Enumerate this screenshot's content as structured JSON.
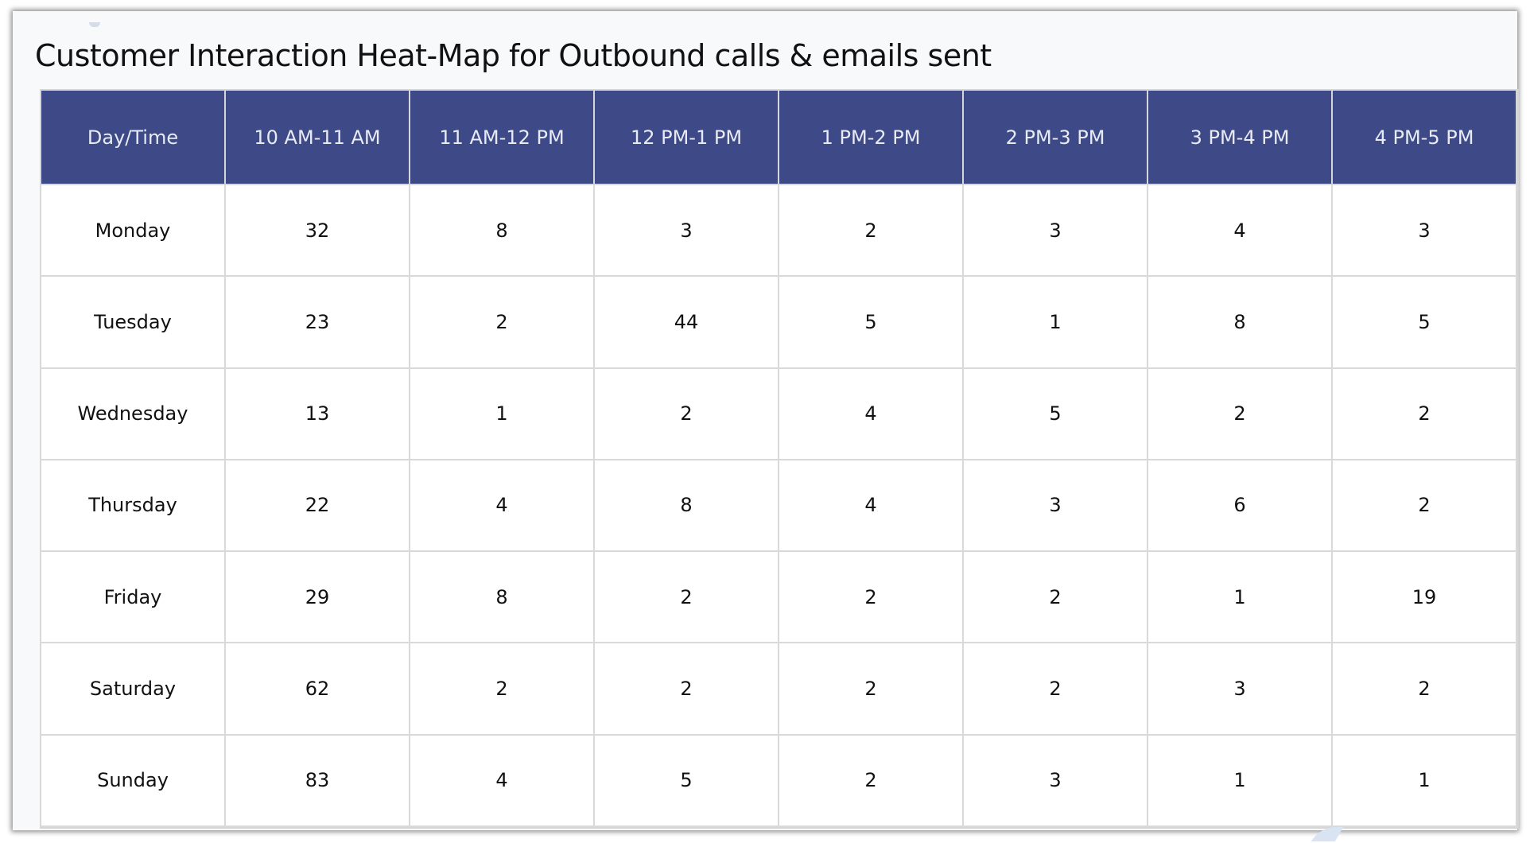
{
  "chart_data": {
    "type": "heatmap",
    "title": "Customer Interaction Heat-Map for Outbound calls & emails sent",
    "corner_label": "Day/Time",
    "columns": [
      "10 AM-11 AM",
      "11 AM-12 PM",
      "12 PM-1 PM",
      "1 PM-2 PM",
      "2 PM-3 PM",
      "3 PM-4 PM",
      "4 PM-5 PM"
    ],
    "rows": [
      {
        "label": "Monday",
        "values": [
          32,
          8,
          3,
          2,
          3,
          4,
          3
        ]
      },
      {
        "label": "Tuesday",
        "values": [
          23,
          2,
          44,
          5,
          1,
          8,
          5
        ]
      },
      {
        "label": "Wednesday",
        "values": [
          13,
          1,
          2,
          4,
          5,
          2,
          2
        ]
      },
      {
        "label": "Thursday",
        "values": [
          22,
          4,
          8,
          4,
          3,
          6,
          2
        ]
      },
      {
        "label": "Friday",
        "values": [
          29,
          8,
          2,
          2,
          2,
          1,
          19
        ]
      },
      {
        "label": "Saturday",
        "values": [
          62,
          2,
          2,
          2,
          2,
          3,
          2
        ]
      },
      {
        "label": "Sunday",
        "values": [
          83,
          4,
          5,
          2,
          3,
          1,
          1
        ]
      }
    ]
  },
  "colors": {
    "header_bg": "#3d4a87",
    "header_text": "#e8ebf5",
    "cell_bg": "#ffffff",
    "grid": "#d9d9d9"
  }
}
